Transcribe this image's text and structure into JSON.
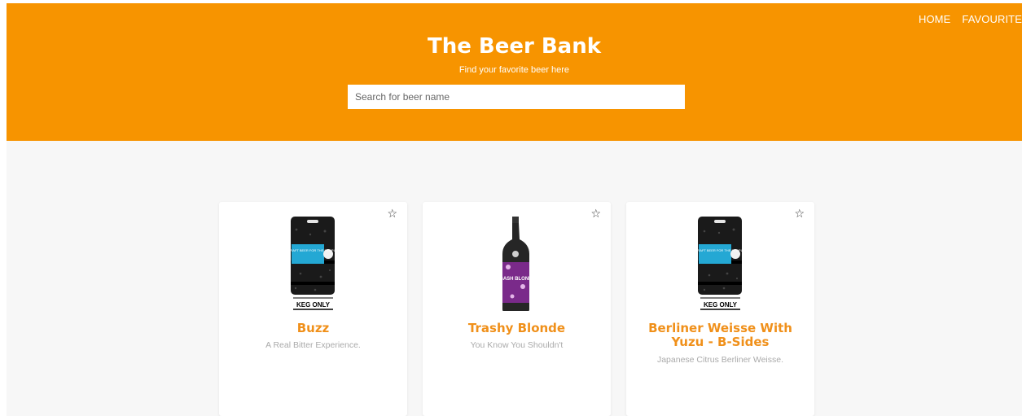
{
  "nav": {
    "home": "HOME",
    "favourite": "FAVOURITE"
  },
  "header": {
    "title": "The Beer Bank",
    "subtitle": "Find your favorite beer here",
    "search_placeholder": "Search for beer name"
  },
  "cards": [
    {
      "name": "Buzz",
      "tagline": "A Real Bitter Experience.",
      "image": "keg",
      "keg_label": "KEG ONLY",
      "keg_text": "CRAFT BEER FOR THE PEOPLE",
      "favourite": false
    },
    {
      "name": "Trashy Blonde",
      "tagline": "You Know You Shouldn't",
      "image": "bottle",
      "bottle_text": "BASH BLOND",
      "favourite": false
    },
    {
      "name": "Berliner Weisse With Yuzu - B-Sides",
      "tagline": "Japanese Citrus Berliner Weisse.",
      "image": "keg",
      "keg_label": "KEG ONLY",
      "keg_text": "CRAFT BEER FOR THE PEOPLE",
      "favourite": false
    }
  ],
  "icons": {
    "favourite": "star-outline-icon"
  },
  "colors": {
    "header": "#f79400",
    "accent": "#f0901a",
    "background": "#f7f7f7"
  }
}
